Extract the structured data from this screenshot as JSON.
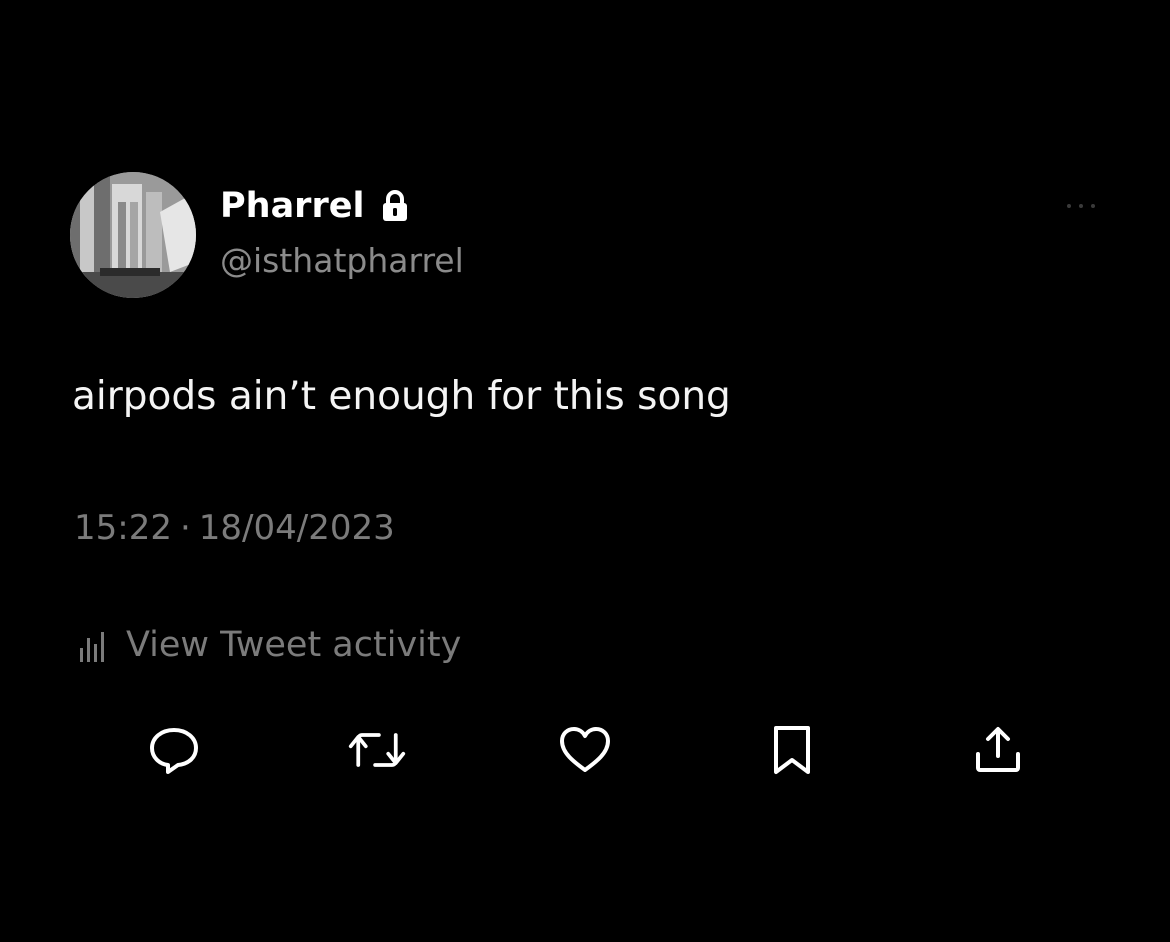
{
  "user": {
    "display_name": "Pharrel",
    "handle": "@isthatpharrel",
    "protected_icon": "lock-icon",
    "avatar": "profile-avatar"
  },
  "tweet": {
    "text": "airpods ain’t enough for this song",
    "time": "15:22",
    "separator": "·",
    "date": "18/04/2023"
  },
  "activity": {
    "icon": "bar-chart-icon",
    "label": "View Tweet activity"
  },
  "actions": [
    {
      "name": "reply",
      "icon": "reply-icon"
    },
    {
      "name": "retweet",
      "icon": "retweet-icon"
    },
    {
      "name": "like",
      "icon": "heart-icon"
    },
    {
      "name": "bookmark",
      "icon": "bookmark-icon"
    },
    {
      "name": "share",
      "icon": "share-icon"
    }
  ],
  "more": {
    "icon": "more-icon"
  },
  "colors": {
    "background": "#000000",
    "primary_text": "#ffffff",
    "secondary_text": "#7b7b7b"
  }
}
